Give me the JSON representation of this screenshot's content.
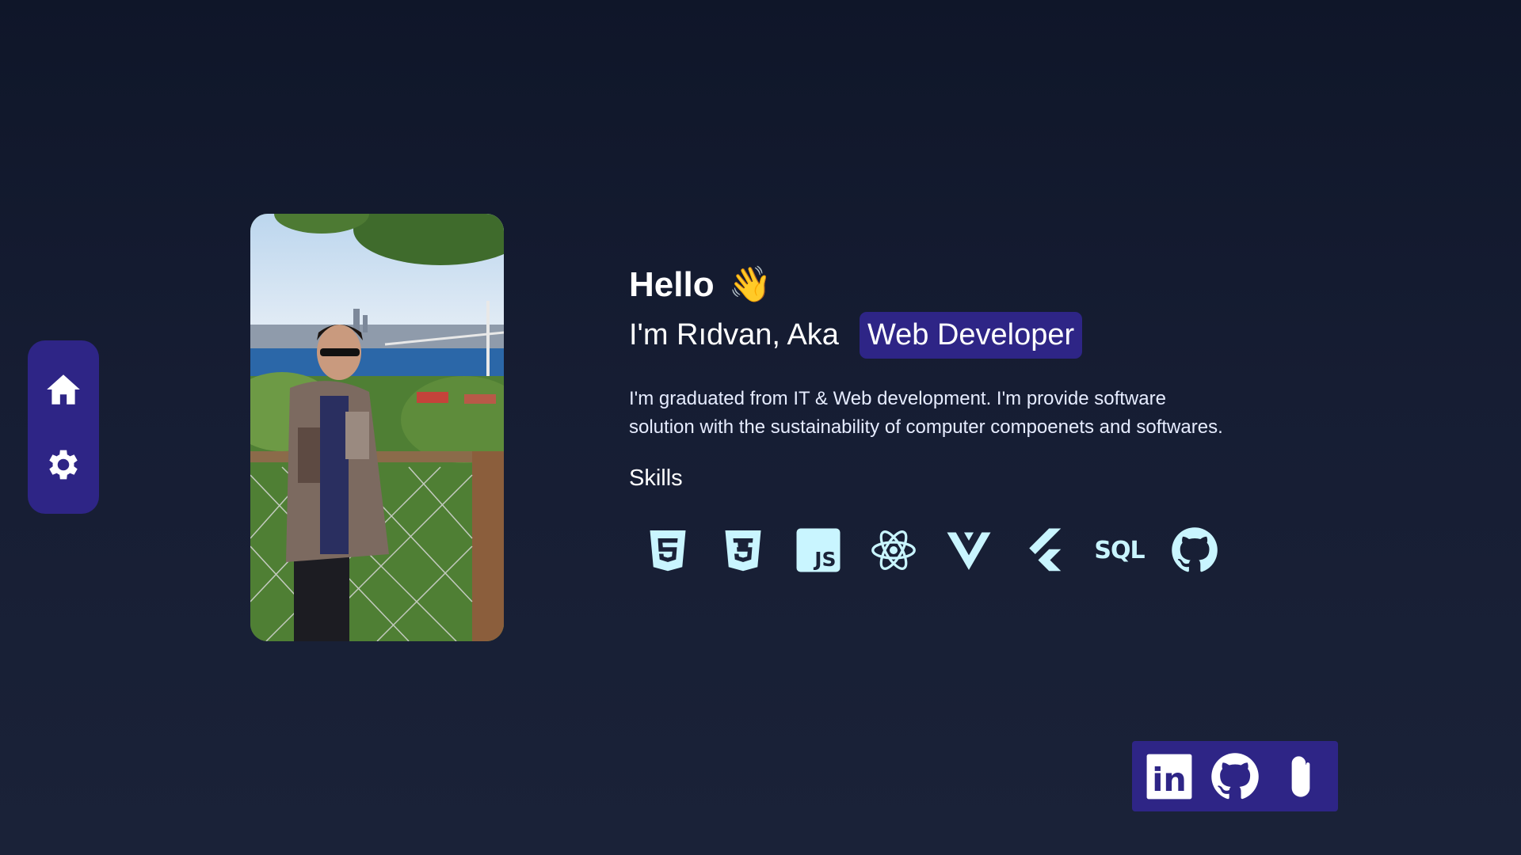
{
  "nav": {
    "items": [
      {
        "icon": "home-icon"
      },
      {
        "icon": "gear-icon"
      }
    ]
  },
  "profile": {
    "photo_alt": "Profile photo"
  },
  "intro": {
    "hello": "Hello",
    "wave": "👋",
    "name_prefix": "I'm Rıdvan, Aka",
    "role": "Web Developer",
    "description_line1": "I'm graduated from IT & Web development. I'm provide software",
    "description_line2": "solution with the sustainability of computer compoenets and softwares.",
    "skills_title": "Skills"
  },
  "skills": [
    {
      "icon": "html5-icon"
    },
    {
      "icon": "css3-icon"
    },
    {
      "icon": "javascript-icon",
      "label": "JS"
    },
    {
      "icon": "react-icon"
    },
    {
      "icon": "vue-icon"
    },
    {
      "icon": "flutter-icon"
    },
    {
      "icon": "sql-icon",
      "label": "SQL"
    },
    {
      "icon": "github-icon"
    }
  ],
  "social": [
    {
      "icon": "linkedin-icon",
      "label": "in"
    },
    {
      "icon": "github-icon"
    },
    {
      "icon": "paperclip-icon"
    }
  ],
  "colors": {
    "accent": "#2e2586",
    "background_top": "#0f1629",
    "background_bottom": "#1a2238",
    "skill_icon": "#c9f5ff"
  }
}
